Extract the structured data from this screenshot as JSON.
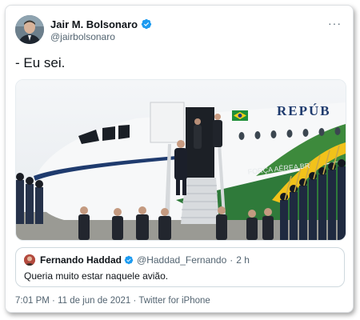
{
  "tweet": {
    "author_name": "Jair M. Bolsonaro",
    "author_handle": "@jairbolsonaro",
    "more_icon": "···",
    "text": "- Eu sei.",
    "timestamp": "7:01 PM",
    "separator_1": " · ",
    "date": "11 de jun de 2021",
    "separator_2": " · ",
    "source": "Twitter for iPhone"
  },
  "image": {
    "plane_text_republic": "REPÚB",
    "plane_text_forca": "FORÇA AÉREA BR"
  },
  "quoted_tweet": {
    "author_name": "Fernando Haddad",
    "author_handle": "@Haddad_Fernando",
    "separator": "·",
    "time": "2 h",
    "text": "Queria muito estar naquele avião."
  },
  "colors": {
    "verified_blue": "#1d9bf0",
    "text_primary": "#0f1419",
    "text_secondary": "#536471"
  }
}
